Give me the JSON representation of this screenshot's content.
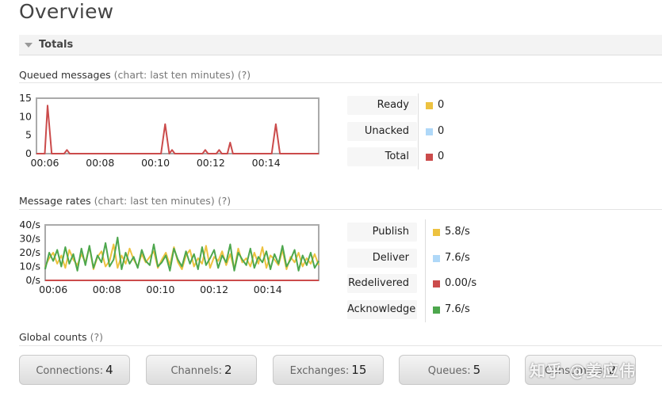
{
  "page": {
    "title": "Overview"
  },
  "totals_section": {
    "label": "Totals"
  },
  "queued": {
    "heading": "Queued messages",
    "note": "(chart: last ten minutes)",
    "help": "(?)",
    "legend": [
      {
        "label": "Ready",
        "value": "0",
        "color": "#edc240"
      },
      {
        "label": "Unacked",
        "value": "0",
        "color": "#afd8f8"
      },
      {
        "label": "Total",
        "value": "0",
        "color": "#cb4b4b"
      }
    ]
  },
  "rates": {
    "heading": "Message rates",
    "note": "(chart: last ten minutes)",
    "help": "(?)",
    "legend": [
      {
        "label": "Publish",
        "value": "5.8/s",
        "color": "#edc240"
      },
      {
        "label": "Deliver",
        "value": "7.6/s",
        "color": "#afd8f8"
      },
      {
        "label": "Redelivered",
        "value": "0.00/s",
        "color": "#cb4b4b"
      },
      {
        "label": "Acknowledge",
        "value": "7.6/s",
        "color": "#4da74d"
      }
    ]
  },
  "global": {
    "heading": "Global counts",
    "help": "(?)",
    "counts": [
      {
        "label": "Connections:",
        "value": "4"
      },
      {
        "label": "Channels:",
        "value": "2"
      },
      {
        "label": "Exchanges:",
        "value": "15"
      },
      {
        "label": "Queues:",
        "value": "5"
      },
      {
        "label": "Consumers:",
        "value": "2"
      }
    ]
  },
  "watermark": "知乎 @姜应伟",
  "chart_data": [
    {
      "type": "line",
      "x_ticks": [
        "00:06",
        "00:08",
        "00:10",
        "00:12",
        "00:14"
      ],
      "y_ticks": [
        "0",
        "5",
        "10",
        "15"
      ],
      "ylim": [
        0,
        15
      ],
      "xlim": [
        5.7,
        15.9
      ],
      "grid": false,
      "series": [
        {
          "name": "Total",
          "color": "#cb4b4b",
          "x": [
            5.7,
            6.0,
            6.1,
            6.25,
            6.4,
            6.7,
            6.8,
            6.9,
            7.0,
            10.2,
            10.35,
            10.5,
            10.6,
            10.7,
            10.8,
            11.7,
            11.8,
            11.9,
            12.2,
            12.3,
            12.4,
            12.6,
            12.7,
            12.8,
            14.2,
            14.35,
            14.5,
            15.9
          ],
          "values": [
            0,
            0,
            13,
            0,
            0,
            0,
            1,
            0,
            0,
            0,
            8,
            0,
            1,
            0,
            0,
            0,
            1,
            0,
            0,
            1,
            0,
            0,
            3,
            0,
            0,
            8,
            0,
            0
          ]
        }
      ]
    },
    {
      "type": "line",
      "x_ticks": [
        "00:06",
        "00:08",
        "00:10",
        "00:12",
        "00:14"
      ],
      "y_ticks": [
        "0/s",
        "10/s",
        "20/s",
        "30/s",
        "40/s"
      ],
      "ylim": [
        0,
        40
      ],
      "xlim": [
        5.7,
        15.9
      ],
      "grid": false,
      "series": [
        {
          "name": "Publish",
          "color": "#edc240",
          "x": [
            5.7,
            5.85,
            6.0,
            6.15,
            6.3,
            6.45,
            6.6,
            6.75,
            6.9,
            7.05,
            7.2,
            7.35,
            7.5,
            7.65,
            7.8,
            7.95,
            8.1,
            8.25,
            8.4,
            8.55,
            8.7,
            8.85,
            9.0,
            9.15,
            9.3,
            9.45,
            9.6,
            9.75,
            9.9,
            10.05,
            10.2,
            10.35,
            10.5,
            10.65,
            10.8,
            10.95,
            11.1,
            11.25,
            11.4,
            11.55,
            11.7,
            11.85,
            12.0,
            12.15,
            12.3,
            12.45,
            12.6,
            12.75,
            12.9,
            13.05,
            13.2,
            13.35,
            13.5,
            13.65,
            13.8,
            13.95,
            14.1,
            14.25,
            14.4,
            14.55,
            14.7,
            14.85,
            15.0,
            15.15,
            15.3,
            15.45,
            15.6,
            15.75,
            15.9
          ],
          "values": [
            10,
            16,
            20,
            12,
            18,
            9,
            22,
            15,
            11,
            19,
            13,
            24,
            8,
            17,
            21,
            10,
            14,
            26,
            9,
            18,
            12,
            23,
            15,
            10,
            19,
            13,
            17,
            21,
            9,
            15,
            20,
            11,
            24,
            13,
            8,
            18,
            22,
            10,
            16,
            12,
            25,
            9,
            17,
            14,
            21,
            11,
            19,
            8,
            23,
            13,
            16,
            10,
            20,
            12,
            24,
            9,
            18,
            15,
            11,
            22,
            8,
            17,
            13,
            20,
            10,
            16,
            12,
            19,
            11
          ]
        },
        {
          "name": "Acknowledge",
          "color": "#4da74d",
          "x": [
            5.7,
            5.85,
            6.0,
            6.15,
            6.3,
            6.45,
            6.6,
            6.75,
            6.9,
            7.05,
            7.2,
            7.35,
            7.5,
            7.65,
            7.8,
            7.95,
            8.1,
            8.25,
            8.4,
            8.55,
            8.7,
            8.85,
            9.0,
            9.15,
            9.3,
            9.45,
            9.6,
            9.75,
            9.9,
            10.05,
            10.2,
            10.35,
            10.5,
            10.65,
            10.8,
            10.95,
            11.1,
            11.25,
            11.4,
            11.55,
            11.7,
            11.85,
            12.0,
            12.15,
            12.3,
            12.45,
            12.6,
            12.75,
            12.9,
            13.05,
            13.2,
            13.35,
            13.5,
            13.65,
            13.8,
            13.95,
            14.1,
            14.25,
            14.4,
            14.55,
            14.7,
            14.85,
            15.0,
            15.15,
            15.3,
            15.45,
            15.6,
            15.75,
            15.9
          ],
          "values": [
            8,
            20,
            14,
            22,
            10,
            24,
            12,
            19,
            7,
            23,
            11,
            25,
            9,
            18,
            13,
            27,
            10,
            15,
            31,
            8,
            20,
            12,
            17,
            9,
            22,
            14,
            11,
            26,
            10,
            13,
            18,
            7,
            23,
            15,
            10,
            21,
            12,
            19,
            8,
            24,
            11,
            16,
            22,
            9,
            18,
            13,
            26,
            7,
            20,
            15,
            11,
            23,
            9,
            17,
            13,
            21,
            8,
            19,
            12,
            25,
            10,
            15,
            22,
            7,
            18,
            11,
            20,
            9,
            14
          ]
        },
        {
          "name": "Redelivered",
          "color": "#cb4b4b",
          "x": [
            5.7,
            15.9
          ],
          "values": [
            0,
            0
          ]
        }
      ]
    }
  ]
}
